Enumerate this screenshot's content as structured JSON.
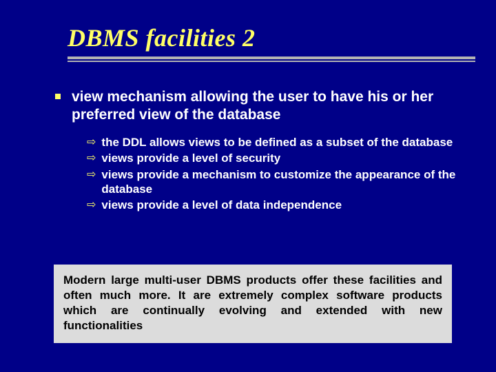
{
  "title": "DBMS facilities 2",
  "main_bullet": "view mechanism allowing the user to have his or her preferred view of the database",
  "sub_bullets": [
    "the DDL allows views to be defined as a subset of the database",
    "views provide a level of security",
    "views provide a mechanism to customize the appearance of the database",
    "views provide a level of data independence"
  ],
  "bottom_box": "Modern large multi-user DBMS products offer these facilities and often much more. It are extremely complex software products which are continually evolving and extended with new functionalities",
  "arrow_glyph": "⇨"
}
